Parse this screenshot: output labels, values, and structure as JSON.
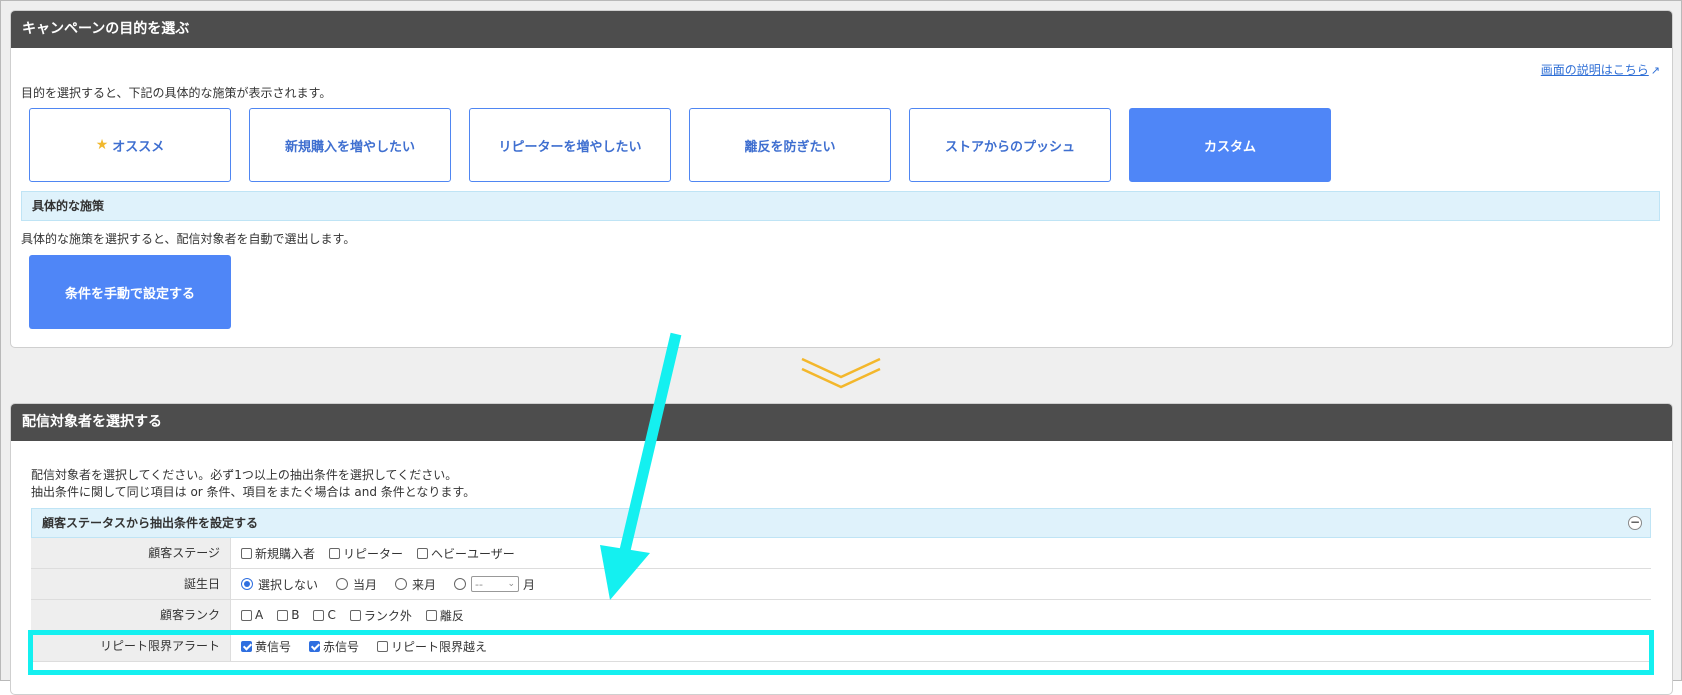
{
  "objective_panel": {
    "title": "キャンペーンの目的を選ぶ",
    "help_link": "画面の説明はこちら",
    "description": "目的を選択すると、下記の具体的な施策が表示されます。",
    "objectives": [
      {
        "label": "オススメ",
        "icon": "star-icon",
        "active": false
      },
      {
        "label": "新規購入を増やしたい",
        "active": false
      },
      {
        "label": "リピーターを増やしたい",
        "active": false
      },
      {
        "label": "離反を防ぎたい",
        "active": false
      },
      {
        "label": "ストアからのプッシュ",
        "active": false
      },
      {
        "label": "カスタム",
        "active": true
      }
    ],
    "measures_section": "具体的な施策",
    "measures_description": "具体的な施策を選択すると、配信対象者を自動で選出します。",
    "manual_button": "条件を手動で設定する"
  },
  "target_panel": {
    "title": "配信対象者を選択する",
    "description_line1": "配信対象者を選択してください。必ず1つ以上の抽出条件を選択してください。",
    "description_line2": "抽出条件に関して同じ項目は or 条件、項目をまたぐ場合は and 条件となります。",
    "filter_section": "顧客ステータスから抽出条件を設定する",
    "collapse_icon": "−",
    "rows": [
      {
        "label": "顧客ステージ",
        "options": [
          {
            "type": "checkbox",
            "label": "新規購入者",
            "checked": false
          },
          {
            "type": "checkbox",
            "label": "リピーター",
            "checked": false
          },
          {
            "type": "checkbox",
            "label": "ヘビーユーザー",
            "checked": false
          }
        ]
      },
      {
        "label": "誕生日",
        "options": [
          {
            "type": "radio",
            "label": "選択しない",
            "checked": true
          },
          {
            "type": "radio",
            "label": "当月",
            "checked": false
          },
          {
            "type": "radio",
            "label": "来月",
            "checked": false
          }
        ],
        "month_select_value": "--",
        "month_suffix": "月"
      },
      {
        "label": "顧客ランク",
        "options": [
          {
            "type": "checkbox",
            "label": "A",
            "checked": false
          },
          {
            "type": "checkbox",
            "label": "B",
            "checked": false
          },
          {
            "type": "checkbox",
            "label": "C",
            "checked": false
          },
          {
            "type": "checkbox",
            "label": "ランク外",
            "checked": false
          },
          {
            "type": "checkbox",
            "label": "離反",
            "checked": false
          }
        ]
      },
      {
        "label": "リピート限界アラート",
        "options": [
          {
            "type": "checkbox",
            "label": "黄信号",
            "checked": true
          },
          {
            "type": "checkbox",
            "label": "赤信号",
            "checked": true
          },
          {
            "type": "checkbox",
            "label": "リピート限界越え",
            "checked": false
          }
        ]
      }
    ]
  },
  "colors": {
    "header_bg": "#4d4d4d",
    "accent_blue": "#4f86f7",
    "section_bg": "#dff2fb",
    "annotation_cyan": "#14f0f0",
    "chevron_yellow": "#f3b72c"
  }
}
